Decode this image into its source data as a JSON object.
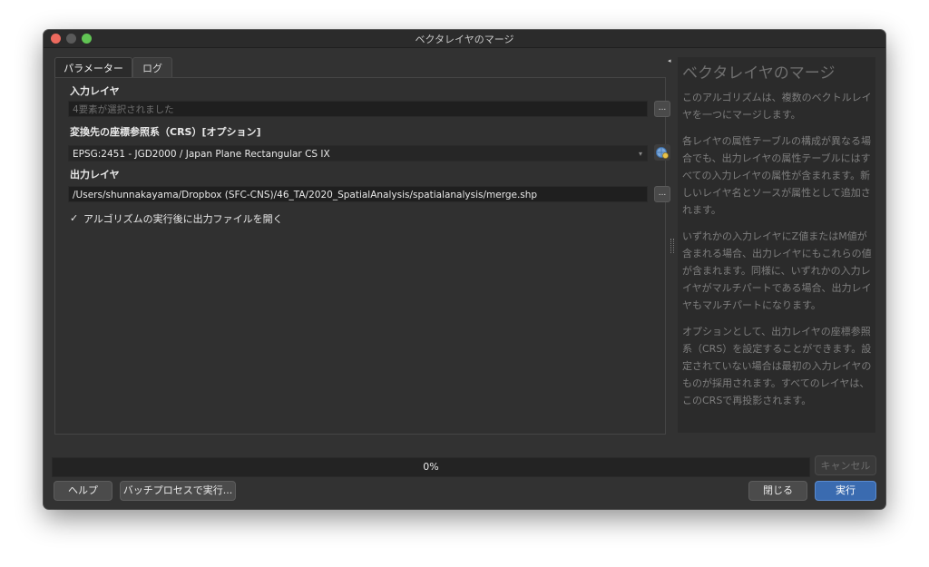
{
  "window": {
    "title": "ベクタレイヤのマージ"
  },
  "tabs": [
    {
      "label": "パラメーター",
      "active": true
    },
    {
      "label": "ログ",
      "active": false
    }
  ],
  "params": {
    "input_layer": {
      "label": "入力レイヤ",
      "value": "4要素が選択されました",
      "button_label": "..."
    },
    "crs": {
      "label": "変換先の座標参照系（CRS）[オプション]",
      "value": "EPSG:2451 - JGD2000 / Japan Plane Rectangular CS IX",
      "arrow": "▾"
    },
    "output_layer": {
      "label": "出力レイヤ",
      "value": "/Users/shunnakayama/Dropbox (SFC-CNS)/46_TA/2020_SpatialAnalysis/spatialanalysis/merge.shp",
      "button_label": "..."
    },
    "open_after": {
      "label": "アルゴリズムの実行後に出力ファイルを開く",
      "checked": true,
      "check_glyph": "✓"
    }
  },
  "help": {
    "collapse_glyph": "◂",
    "title": "ベクタレイヤのマージ",
    "paragraphs": [
      "このアルゴリズムは、複数のベクトルレイヤを一つにマージします。",
      "各レイヤの属性テーブルの構成が異なる場合でも、出力レイヤの属性テーブルにはすべての入力レイヤの属性が含まれます。新しいレイヤ名とソースが属性として追加されます。",
      "いずれかの入力レイヤにZ値またはM値が含まれる場合、出力レイヤにもこれらの値が含まれます。同様に、いずれかの入力レイヤがマルチパートである場合、出力レイヤもマルチパートになります。",
      "オプションとして、出力レイヤの座標参照系（CRS）を設定することができます。設定されていない場合は最初の入力レイヤのものが採用されます。すべてのレイヤは、このCRSで再投影されます。"
    ]
  },
  "progress": {
    "value": 0,
    "text": "0%"
  },
  "buttons": {
    "cancel": "キャンセル",
    "help": "ヘルプ",
    "batch": "バッチプロセスで実行...",
    "close": "閉じる",
    "run": "実行"
  }
}
